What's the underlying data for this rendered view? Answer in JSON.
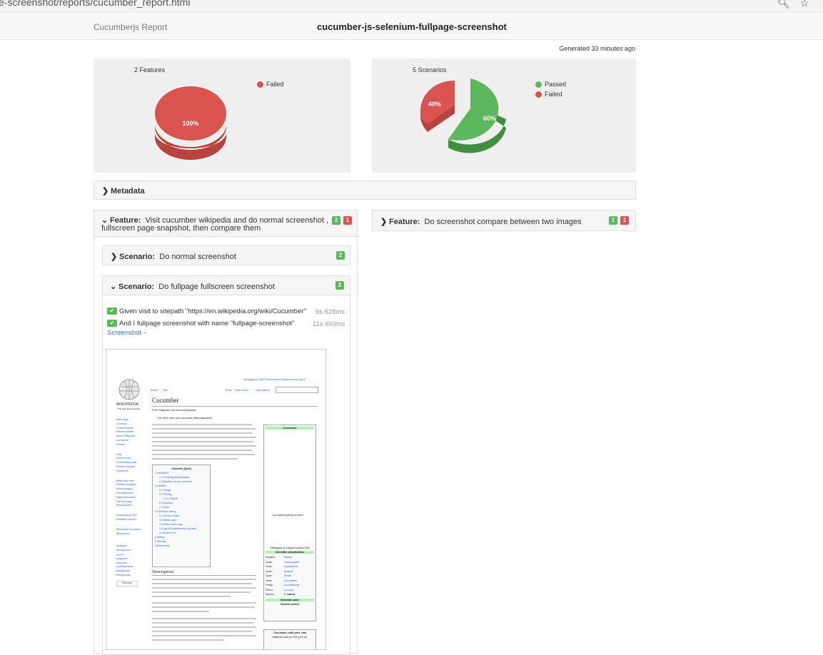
{
  "browser": {
    "url": "e-screenshot/reports/cucumber_report.html"
  },
  "header": {
    "brand": "Cucumberjs Report",
    "title": "cucumber-js-selenium-fullpage-screenshot"
  },
  "generated": "Generated 33 minutes ago",
  "features_panel": {
    "title": "2 Features",
    "legend": [
      "Failed"
    ],
    "slice_label": "100%"
  },
  "scenarios_panel": {
    "title": "5 Scenarios",
    "legend": [
      "Passed",
      "Failed"
    ],
    "passed_label": "60%",
    "failed_label": "40%"
  },
  "chart_data": [
    {
      "type": "pie",
      "title": "2 Features",
      "categories": [
        "Failed"
      ],
      "values": [
        100
      ],
      "colors": [
        "#d9534f"
      ]
    },
    {
      "type": "pie",
      "title": "5 Scenarios",
      "categories": [
        "Passed",
        "Failed"
      ],
      "values": [
        60,
        40
      ],
      "colors": [
        "#5cb85c",
        "#d9534f"
      ]
    }
  ],
  "colors": {
    "passed": "#5cb85c",
    "failed": "#d9534f"
  },
  "metadata": {
    "label": "Metadata"
  },
  "feature1": {
    "keyword": "Feature:",
    "name_line1": "Visit cucumber wikipedia and do normal screenshot ,",
    "name_line2": "fullscreen page snapshot, then compare them",
    "passed": "2",
    "failed": "1",
    "scenario1": {
      "keyword": "Scenario:",
      "name": "Do normal screenshot",
      "passed": "2"
    },
    "scenario2": {
      "keyword": "Scenario:",
      "name": "Do fullpage fullscreen screenshot",
      "passed": "2",
      "steps": [
        {
          "text": "Given visit to sitepath \"https://en.wikipedia.org/wiki/Cucumber\"",
          "duration": "8s 628ms"
        },
        {
          "text": "And I fullpage screenshot with name \"fullpage-screenshot\"",
          "duration": "11s 693ms"
        }
      ],
      "screenshot_link": "Screenshot -"
    }
  },
  "feature2": {
    "keyword": "Feature:",
    "name": "Do screenshot compare between two images",
    "passed": "1",
    "failed": "1"
  },
  "wiki": {
    "logo": "WIKIPEDIA",
    "tagline": "The Free Encyclopedia",
    "title": "Cucumber",
    "from": "From Wikipedia, the free encyclopedia",
    "tabs": [
      "Article",
      "Talk"
    ],
    "actions": [
      "Read",
      "View source",
      "View history"
    ],
    "userlinks": "Not logged in  Talk  Contributions  Create account  Log in",
    "hatnote": "For other uses, see Cucumber (disambiguation).",
    "nav": [
      "Main page",
      "Contents",
      "Current events",
      "Random article",
      "About Wikipedia",
      "Contact us",
      "Donate"
    ],
    "contribute": [
      "Help",
      "Learn to edit",
      "Community portal",
      "Recent changes",
      "Upload file"
    ],
    "tools": [
      "What links here",
      "Related changes",
      "Special pages",
      "Permanent link",
      "Page information",
      "Cite this page",
      "Wikidata item"
    ],
    "print": [
      "Download as PDF",
      "Printable version"
    ],
    "projects": [
      "Wikimedia Commons",
      "Wikispecies"
    ],
    "languages": [
      "Afrikaans",
      "Alemannisch",
      "العربية",
      "Aragonés",
      "Asturianu",
      "Azərbaycanca",
      "Башҡортса",
      "Беларуская"
    ],
    "more_lang": "145 more",
    "toc_title": "Contents [hide]",
    "toc": [
      "1 Description",
      "1.1 Flowering and pollination",
      "1.2 Nutrition, aroma, and taste",
      "2 Varieties",
      "2.1 Slicing",
      "2.2 Pickling",
      "2.2.1 Gherkin",
      "2.3 Burpless",
      "2.4 Other",
      "3 Cultivation history",
      "3.1 Roman Empire",
      "3.2 Middle Ages",
      "3.3 Early-modern age",
      "3.4 Age of Enlightenment and later",
      "3.5 Modern era",
      "4 Gallery",
      "5 See also",
      "6 References"
    ],
    "section": "Description",
    "infobox_title": "Cucumber",
    "photo_caption": "Cucumbers growing on vines",
    "photo2_caption": "Photograph of a single cucumber fruit",
    "sci_class": "Scientific classification",
    "taxonomy": [
      [
        "Kingdom:",
        "Plantae"
      ],
      [
        "Clade:",
        "Tracheophytes"
      ],
      [
        "Clade:",
        "Angiosperms"
      ],
      [
        "Clade:",
        "Eudicots"
      ],
      [
        "Clade:",
        "Rosids"
      ],
      [
        "Order:",
        "Cucurbitales"
      ],
      [
        "Family:",
        "Cucurbitaceae"
      ],
      [
        "Genus:",
        "Cucumis"
      ],
      [
        "Species:",
        "C. sativus"
      ]
    ],
    "binomial": "Binomial name",
    "binomial_name": "Cucumis sativus",
    "nutrition": "Cucumber, with peel, raw",
    "nutrition_sub": "Nutritional value per 100 g (3.5 oz)"
  }
}
